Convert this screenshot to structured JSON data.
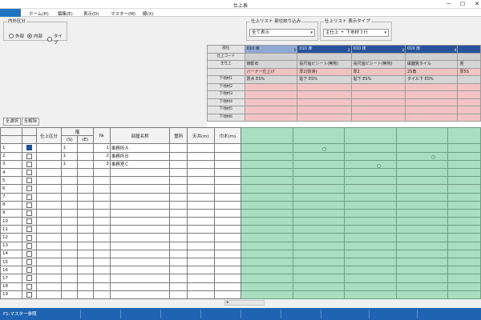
{
  "window": {
    "title": "仕上表"
  },
  "menu": {
    "items": [
      "ホーム(H)",
      "編集(E)",
      "表示(D)",
      "マスター(M)",
      "線(X)"
    ]
  },
  "inout": {
    "label": "内外区分",
    "options": [
      "外部",
      "内部",
      "タイプ"
    ],
    "selected": 1
  },
  "filter": {
    "label": "仕上リスト 部位絞り込み",
    "value": "全て表示"
  },
  "display_type": {
    "label": "仕上リスト 表示タイプ",
    "value": "主仕上 ＋ 下地材３行"
  },
  "buttons": {
    "select_all": "全選択",
    "deselect_all": "全解除"
  },
  "finish_list": {
    "row_labels": [
      "部位",
      "仕上コード",
      "主仕上",
      "",
      "下地材1",
      "下地材2",
      "下地材3",
      "下地材4",
      "下地材5",
      "下地材6"
    ],
    "columns": [
      {
        "part": "010 床",
        "index": "1",
        "main": "御影石",
        "sub": "バーナー仕上げ",
        "base1": "防水 ES%",
        "pink": ""
      },
      {
        "part": "010 床",
        "index": "2",
        "main": "長尺塩ビシート(無地)",
        "sub": "厚2(防滑)",
        "base1": "貼下 ES%",
        "pink": ""
      },
      {
        "part": "010 床",
        "index": "3",
        "main": "長尺塩ビシート(無地)",
        "sub": "厚2",
        "base1": "貼下 ES%",
        "pink": ""
      },
      {
        "part": "010 床",
        "index": "4",
        "main": "磁器質タイル",
        "sub": "2S角",
        "base1": "タイル下 ES%",
        "pink": ""
      },
      {
        "part": "",
        "index": "",
        "main": "畳",
        "sub": "厚5S",
        "base1": "",
        "pink": ""
      }
    ]
  },
  "grid": {
    "headers": {
      "category": "仕上区分",
      "floor": "階",
      "floor_s": "(S)",
      "floor_e": "(E)",
      "no": "№",
      "room": "部屋名称",
      "location": "箇所",
      "ceiling": "天井(m)",
      "width": "巾木(m)"
    },
    "rows": [
      {
        "n": "1",
        "checked": true,
        "floor_s": "1",
        "no": "1",
        "room": "事務所Ａ"
      },
      {
        "n": "2",
        "checked": false,
        "floor_s": "1",
        "no": "2",
        "room": "事務所Ｂ"
      },
      {
        "n": "3",
        "checked": false,
        "floor_s": "1",
        "no": "3",
        "room": "事務室Ｃ"
      },
      {
        "n": "4"
      },
      {
        "n": "5"
      },
      {
        "n": "6"
      },
      {
        "n": "7"
      },
      {
        "n": "8"
      },
      {
        "n": "9"
      },
      {
        "n": "10"
      },
      {
        "n": "11"
      },
      {
        "n": "12"
      },
      {
        "n": "13"
      },
      {
        "n": "14"
      },
      {
        "n": "15"
      },
      {
        "n": "16"
      },
      {
        "n": "17"
      },
      {
        "n": "18"
      },
      {
        "n": "19"
      }
    ],
    "marks": [
      "○",
      "○",
      "○"
    ]
  },
  "status": {
    "text": "F1:マスター参照"
  },
  "colors": {
    "accent": "#1e73be",
    "grid_green": "#a9dec0",
    "pink": "#f3c3c3",
    "header_blue": "#27539b"
  }
}
